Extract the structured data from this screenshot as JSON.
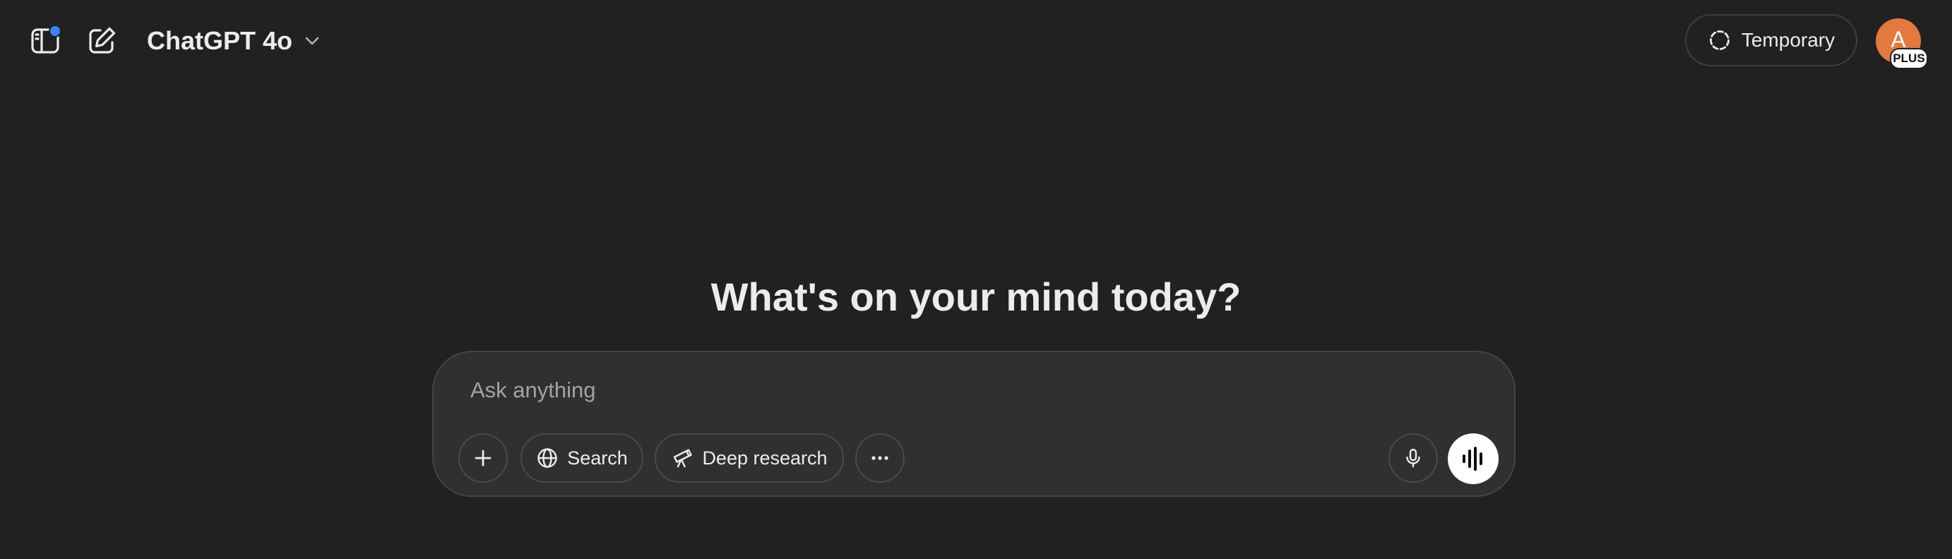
{
  "header": {
    "sidebar_toggle_icon": "sidebar-icon",
    "notification_dot_color": "#3b82f6",
    "new_chat_icon": "compose-icon",
    "model_name": "ChatGPT 4o",
    "model_dropdown_icon": "chevron-down-icon",
    "temporary_label": "Temporary",
    "temporary_icon": "dashed-circle-icon",
    "avatar_initial": "A",
    "avatar_color": "#e2793e",
    "plan_badge": "PLUS"
  },
  "main": {
    "headline": "What's on your mind today?"
  },
  "composer": {
    "placeholder": "Ask anything",
    "value": "",
    "add_icon": "plus-icon",
    "search_label": "Search",
    "search_icon": "globe-icon",
    "deep_research_label": "Deep research",
    "deep_research_icon": "telescope-icon",
    "more_icon": "more-horizontal-icon",
    "dictate_icon": "microphone-icon",
    "voice_icon": "voice-waveform-icon"
  },
  "colors": {
    "background": "#212121",
    "composer_background": "#303030",
    "text": "#ececec",
    "placeholder": "#a3a3a3"
  }
}
